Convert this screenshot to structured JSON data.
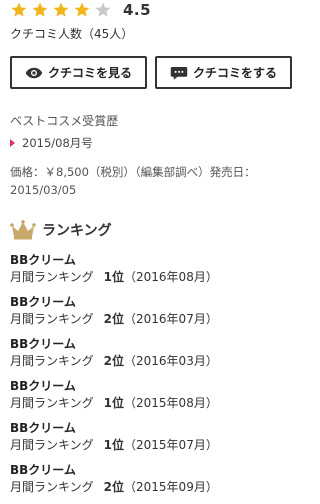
{
  "rating": {
    "value": "4.5",
    "stars_filled": 4,
    "stars_total": 5,
    "review_count": "クチコミ人数（45人）",
    "star_color": "#f2b51c",
    "star_empty_color": "#c9c9c9"
  },
  "buttons": {
    "view_reviews": "クチコミを見る",
    "write_review": "クチコミをする"
  },
  "awards": {
    "heading": "ベストコスメ受賞歴",
    "items": [
      "2015/08月号"
    ],
    "accent_color": "#d6336c"
  },
  "price": {
    "text": "価格：￥8,500（税別）（編集部調べ）発売日：2015/03/05"
  },
  "ranking": {
    "heading": "ランキング",
    "crown_color": "#c9a96a",
    "items": [
      {
        "category": "BBクリーム",
        "type": "月間ランキング",
        "position": "1位",
        "period": "（2016年08月）"
      },
      {
        "category": "BBクリーム",
        "type": "月間ランキング",
        "position": "2位",
        "period": "（2016年07月）"
      },
      {
        "category": "BBクリーム",
        "type": "月間ランキング",
        "position": "2位",
        "period": "（2016年03月）"
      },
      {
        "category": "BBクリーム",
        "type": "月間ランキング",
        "position": "1位",
        "period": "（2015年08月）"
      },
      {
        "category": "BBクリーム",
        "type": "月間ランキング",
        "position": "1位",
        "period": "（2015年07月）"
      },
      {
        "category": "BBクリーム",
        "type": "月間ランキング",
        "position": "2位",
        "period": "（2015年09月）"
      }
    ]
  }
}
